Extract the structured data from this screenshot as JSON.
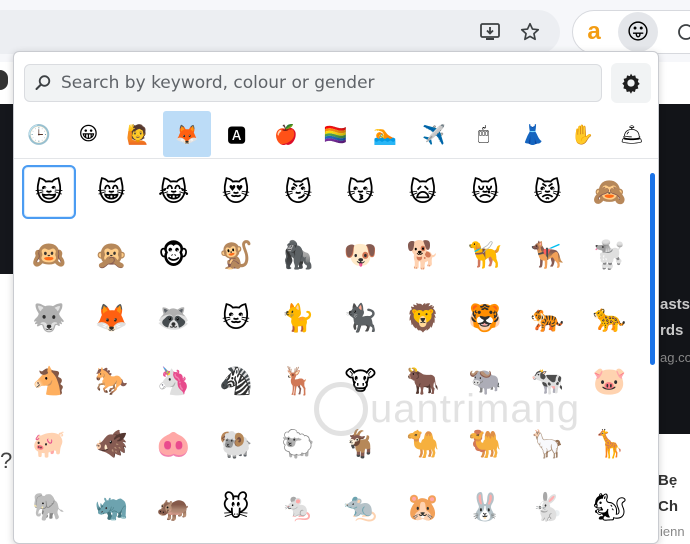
{
  "search": {
    "placeholder": "Search by keyword, colour or gender"
  },
  "toolbar": {
    "install_icon": "install-app-icon",
    "bookmark_icon": "star-icon",
    "extension_a_label": "a",
    "extension_emoji_icon": "tongue-face-emoji-icon"
  },
  "background_page": {
    "left_char": "?",
    "right_lines": [
      "asts",
      "rds",
      "ag.co",
      "Bẹ",
      "Ch",
      "ienn"
    ]
  },
  "watermark": {
    "text": "uantrimang"
  },
  "categories": [
    {
      "name": "recent",
      "glyph": "🕒"
    },
    {
      "name": "smileys",
      "glyph": "😀"
    },
    {
      "name": "people",
      "glyph": "🙋"
    },
    {
      "name": "animals",
      "glyph": "🦊",
      "active": true
    },
    {
      "name": "symbols",
      "glyph": "🅰"
    },
    {
      "name": "food",
      "glyph": "🍎"
    },
    {
      "name": "flags",
      "glyph": "🏳️‍🌈"
    },
    {
      "name": "activities",
      "glyph": "🏊"
    },
    {
      "name": "travel",
      "glyph": "✈️"
    },
    {
      "name": "objects",
      "glyph": "🖱"
    },
    {
      "name": "clothing",
      "glyph": "👗"
    },
    {
      "name": "gestures",
      "glyph": "✋"
    },
    {
      "name": "bell",
      "glyph": "🛎"
    }
  ],
  "emoji_rows": [
    [
      "😺",
      "😸",
      "😹",
      "😻",
      "😼",
      "😽",
      "🙀",
      "😿",
      "😾",
      "🙈"
    ],
    [
      "🙉",
      "🙊",
      "🐵",
      "🐒",
      "🦍",
      "🐶",
      "🐕",
      "🦮",
      "🐕‍🦺",
      "🐩"
    ],
    [
      "🐺",
      "🦊",
      "🦝",
      "🐱",
      "🐈",
      "🐈‍⬛",
      "🦁",
      "🐯",
      "🐅",
      "🐆"
    ],
    [
      "🐴",
      "🐎",
      "🦄",
      "🦓",
      "🦌",
      "🐮",
      "🐂",
      "🐃",
      "🐄",
      "🐷"
    ],
    [
      "🐖",
      "🐗",
      "🐽",
      "🐏",
      "🐑",
      "🐐",
      "🐪",
      "🐫",
      "🦙",
      "🦒"
    ],
    [
      "🐘",
      "🦏",
      "🦛",
      "🐭",
      "🐁",
      "🐀",
      "🐹",
      "🐰",
      "🐇",
      "🐿"
    ]
  ],
  "selected_emoji": "😺",
  "colors": {
    "accent": "#1a73e8",
    "active_tab": "#bcdcf7",
    "selection_border": "#4b9cf2"
  }
}
